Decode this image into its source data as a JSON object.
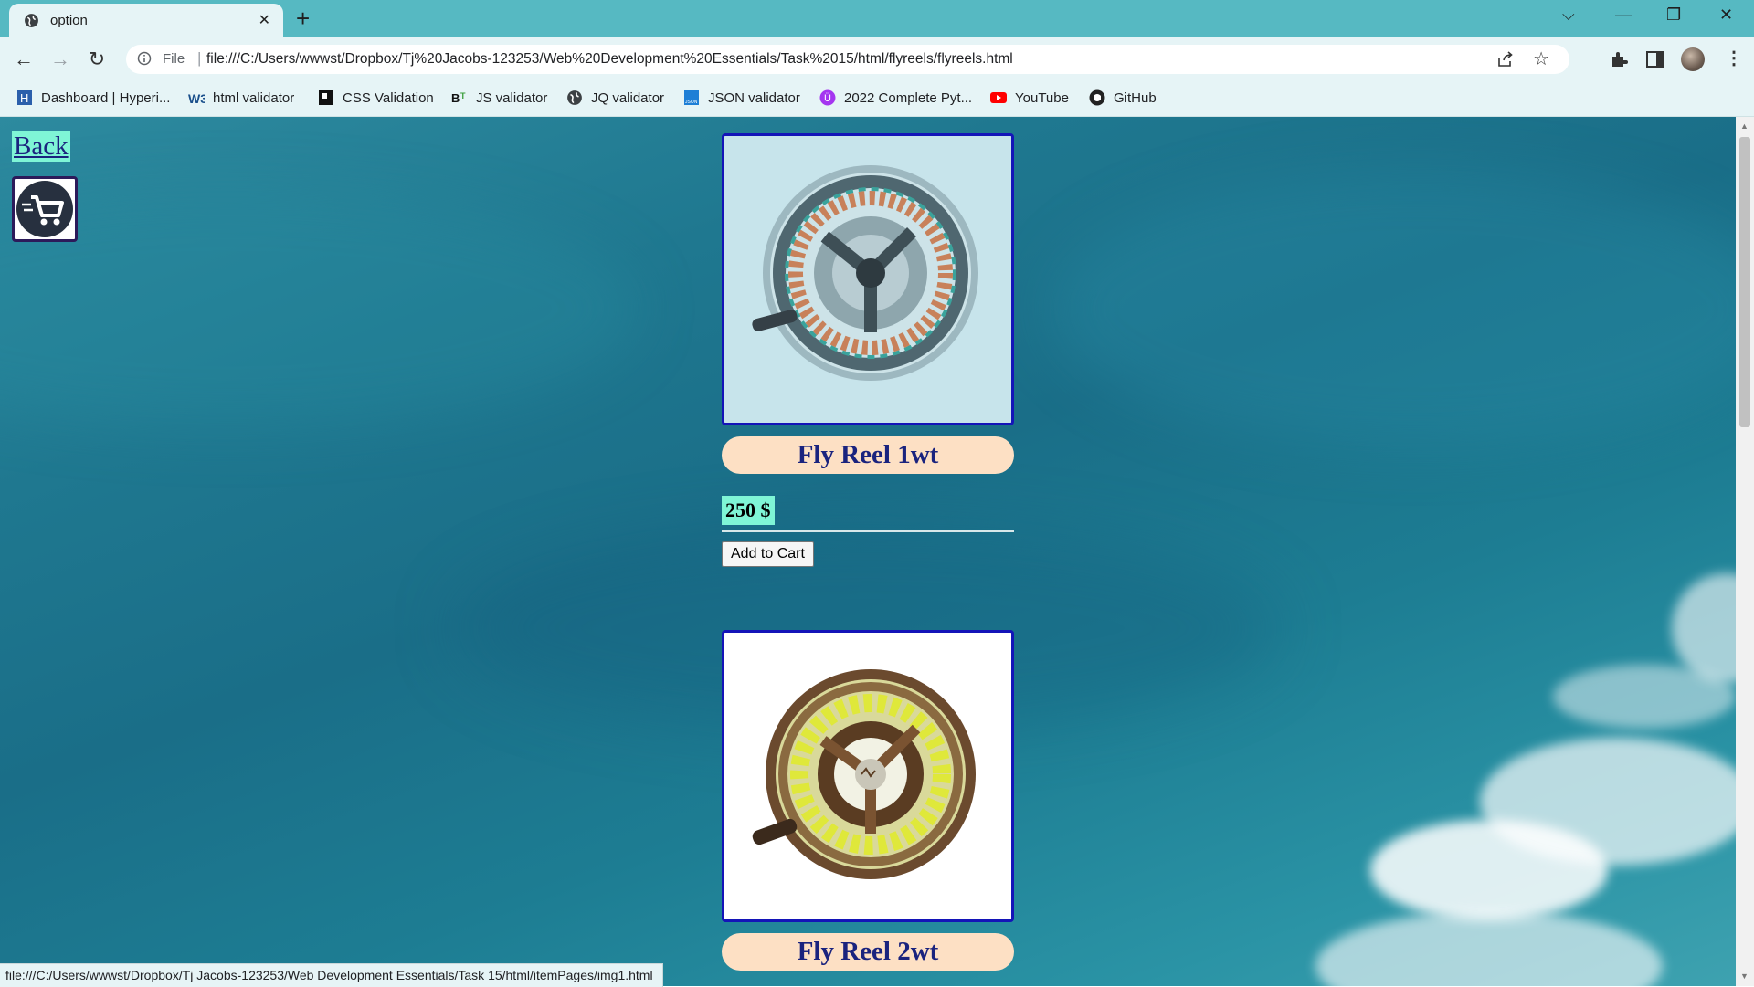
{
  "browser": {
    "tab_title": "option",
    "url_scheme_label": "File",
    "url": "file:///C:/Users/wwwst/Dropbox/Tj%20Jacobs-123253/Web%20Development%20Essentials/Task%2015/html/flyreels/flyreels.html",
    "bookmarks": [
      {
        "label": "Dashboard | Hyperi...",
        "icon": "hyperion-icon"
      },
      {
        "label": "html validator",
        "icon": "w3c-icon"
      },
      {
        "label": "CSS Validation",
        "icon": "css-validation-icon"
      },
      {
        "label": "JS validator",
        "icon": "bt-icon"
      },
      {
        "label": "JQ validator",
        "icon": "globe-icon"
      },
      {
        "label": "JSON validator",
        "icon": "json-icon"
      },
      {
        "label": "2022 Complete Pyt...",
        "icon": "udemy-icon"
      },
      {
        "label": "YouTube",
        "icon": "youtube-icon"
      },
      {
        "label": "GitHub",
        "icon": "github-icon"
      }
    ],
    "status_url": "file:///C:/Users/wwwst/Dropbox/Tj Jacobs-123253/Web Development Essentials/Task 15/html/itemPages/img1.html"
  },
  "page": {
    "back_label": "Back",
    "cart_icon": "shopping-cart-icon",
    "products": [
      {
        "title": "Fly Reel 1wt",
        "price": "250 $",
        "button": "Add to Cart",
        "image": "fly-reel-blue-image"
      },
      {
        "title": "Fly Reel 2wt",
        "image": "fly-reel-bronze-image"
      }
    ]
  },
  "colors": {
    "chrome_accent": "#56b9c2",
    "chrome_bg": "#e6f4f6",
    "link_bg": "#7ff5d6",
    "title_pill": "#fde0c4",
    "image_border": "#1414b8",
    "text_navy": "#1a237e"
  }
}
